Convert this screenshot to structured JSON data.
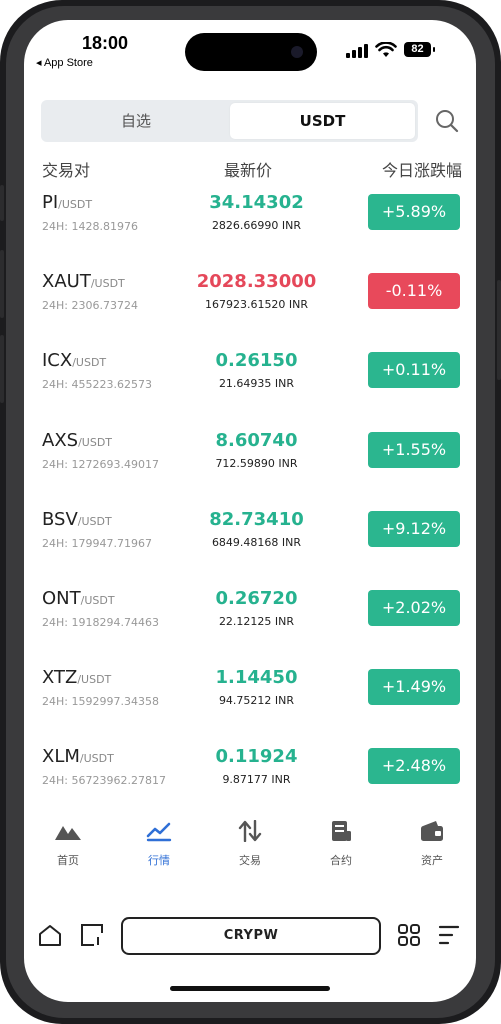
{
  "status": {
    "time": "18:00",
    "back_label": "◂ App Store",
    "battery": "82"
  },
  "segments": [
    {
      "label": "自选"
    },
    {
      "label": "USDT"
    }
  ],
  "headers": {
    "pair": "交易对",
    "price": "最新价",
    "change": "今日涨跌幅"
  },
  "rows": [
    {
      "base": "PI",
      "quote": "/USDT",
      "vol": "24H: 1428.81976",
      "price": "34.14302",
      "fiat": "2826.66990 INR",
      "change": "+5.89%",
      "dir": "up"
    },
    {
      "base": "XAUT",
      "quote": "/USDT",
      "vol": "24H: 2306.73724",
      "price": "2028.33000",
      "fiat": "167923.61520 INR",
      "change": "-0.11%",
      "dir": "down"
    },
    {
      "base": "ICX",
      "quote": "/USDT",
      "vol": "24H: 455223.62573",
      "price": "0.26150",
      "fiat": "21.64935 INR",
      "change": "+0.11%",
      "dir": "up"
    },
    {
      "base": "AXS",
      "quote": "/USDT",
      "vol": "24H: 1272693.49017",
      "price": "8.60740",
      "fiat": "712.59890 INR",
      "change": "+1.55%",
      "dir": "up"
    },
    {
      "base": "BSV",
      "quote": "/USDT",
      "vol": "24H: 179947.71967",
      "price": "82.73410",
      "fiat": "6849.48168 INR",
      "change": "+9.12%",
      "dir": "up"
    },
    {
      "base": "ONT",
      "quote": "/USDT",
      "vol": "24H: 1918294.74463",
      "price": "0.26720",
      "fiat": "22.12125 INR",
      "change": "+2.02%",
      "dir": "up"
    },
    {
      "base": "XTZ",
      "quote": "/USDT",
      "vol": "24H: 1592997.34358",
      "price": "1.14450",
      "fiat": "94.75212 INR",
      "change": "+1.49%",
      "dir": "up"
    },
    {
      "base": "XLM",
      "quote": "/USDT",
      "vol": "24H: 56723962.27817",
      "price": "0.11924",
      "fiat": "9.87177 INR",
      "change": "+2.48%",
      "dir": "up"
    }
  ],
  "tabs": [
    {
      "label": "首页",
      "icon": "mountains-icon"
    },
    {
      "label": "行情",
      "icon": "chart-trend-icon"
    },
    {
      "label": "交易",
      "icon": "transfer-arrows-icon"
    },
    {
      "label": "合约",
      "icon": "contract-doc-icon"
    },
    {
      "label": "资产",
      "icon": "wallet-icon"
    }
  ],
  "browser": {
    "url_text": "CRYPW"
  },
  "colors": {
    "up": "#2bb68f",
    "down": "#e8495b",
    "active_tab": "#2f6fd6"
  }
}
